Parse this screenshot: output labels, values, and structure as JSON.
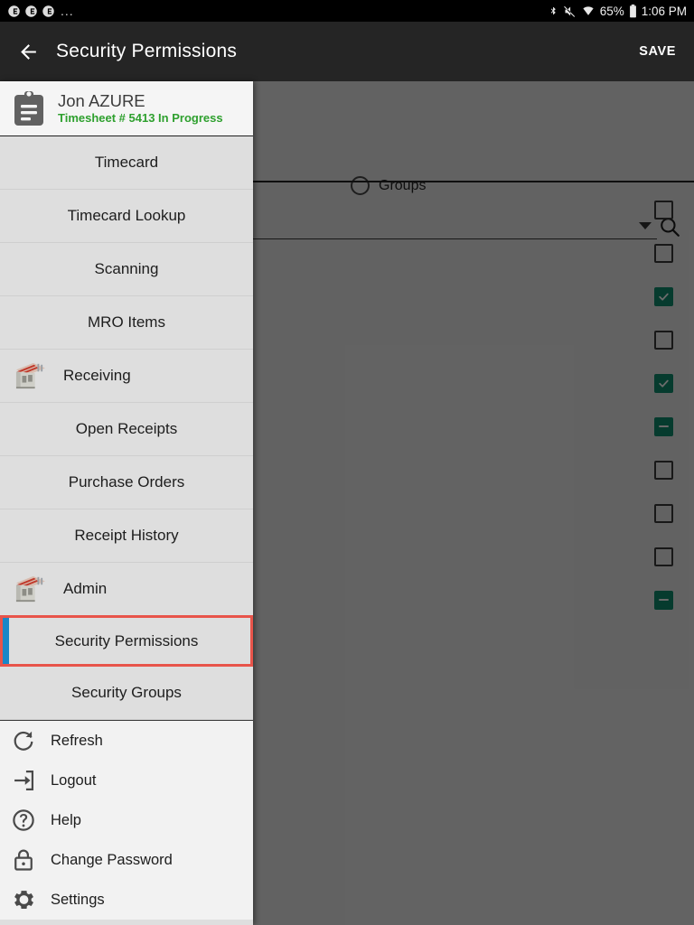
{
  "statusbar": {
    "notification_icons": [
      "notification-icon",
      "notification-icon",
      "notification-icon"
    ],
    "overflow": "...",
    "bluetooth": "bluetooth-icon",
    "mute": "volume-mute-icon",
    "wifi": "wifi-icon",
    "battery_percent": "65%",
    "battery": "battery-icon",
    "time": "1:06 PM"
  },
  "appbar": {
    "back": "back-arrow-icon",
    "title": "Security Permissions",
    "save_label": "SAVE",
    "bg": "#252525"
  },
  "content": {
    "radio_label": "Groups",
    "radio_selected": false,
    "dropdown_value": "",
    "search": "search-icon",
    "checkbox_states": [
      "off",
      "off",
      "on",
      "off",
      "on",
      "partial",
      "off",
      "off",
      "off",
      "partial"
    ],
    "checkbox_accent": "#0c7158"
  },
  "drawer": {
    "header": {
      "icon": "clipboard-icon",
      "user_name": "Jon AZURE",
      "status": "Timesheet # 5413 In Progress",
      "status_color": "#2ea02e"
    },
    "items": [
      {
        "label": "Timecard",
        "type": "child",
        "icon": null,
        "selected": false
      },
      {
        "label": "Timecard Lookup",
        "type": "child",
        "icon": null,
        "selected": false
      },
      {
        "label": "Scanning",
        "type": "child",
        "icon": null,
        "selected": false
      },
      {
        "label": "MRO Items",
        "type": "child",
        "icon": null,
        "selected": false
      },
      {
        "label": "Receiving",
        "type": "parent",
        "icon": "warehouse-icon",
        "selected": false
      },
      {
        "label": "Open Receipts",
        "type": "child",
        "icon": null,
        "selected": false
      },
      {
        "label": "Purchase Orders",
        "type": "child",
        "icon": null,
        "selected": false
      },
      {
        "label": "Receipt History",
        "type": "child",
        "icon": null,
        "selected": false
      },
      {
        "label": "Admin",
        "type": "parent",
        "icon": "warehouse-icon",
        "selected": false
      },
      {
        "label": "Security Permissions",
        "type": "child",
        "icon": null,
        "selected": true
      },
      {
        "label": "Security Groups",
        "type": "child",
        "icon": null,
        "selected": false
      }
    ],
    "selection_border_color": "#e8544a",
    "selection_accent_color": "#1a87c8",
    "footer": [
      {
        "label": "Refresh",
        "icon": "refresh-icon"
      },
      {
        "label": "Logout",
        "icon": "logout-icon"
      },
      {
        "label": "Help",
        "icon": "help-icon"
      },
      {
        "label": "Change Password",
        "icon": "lock-icon"
      },
      {
        "label": "Settings",
        "icon": "gear-icon"
      }
    ]
  }
}
